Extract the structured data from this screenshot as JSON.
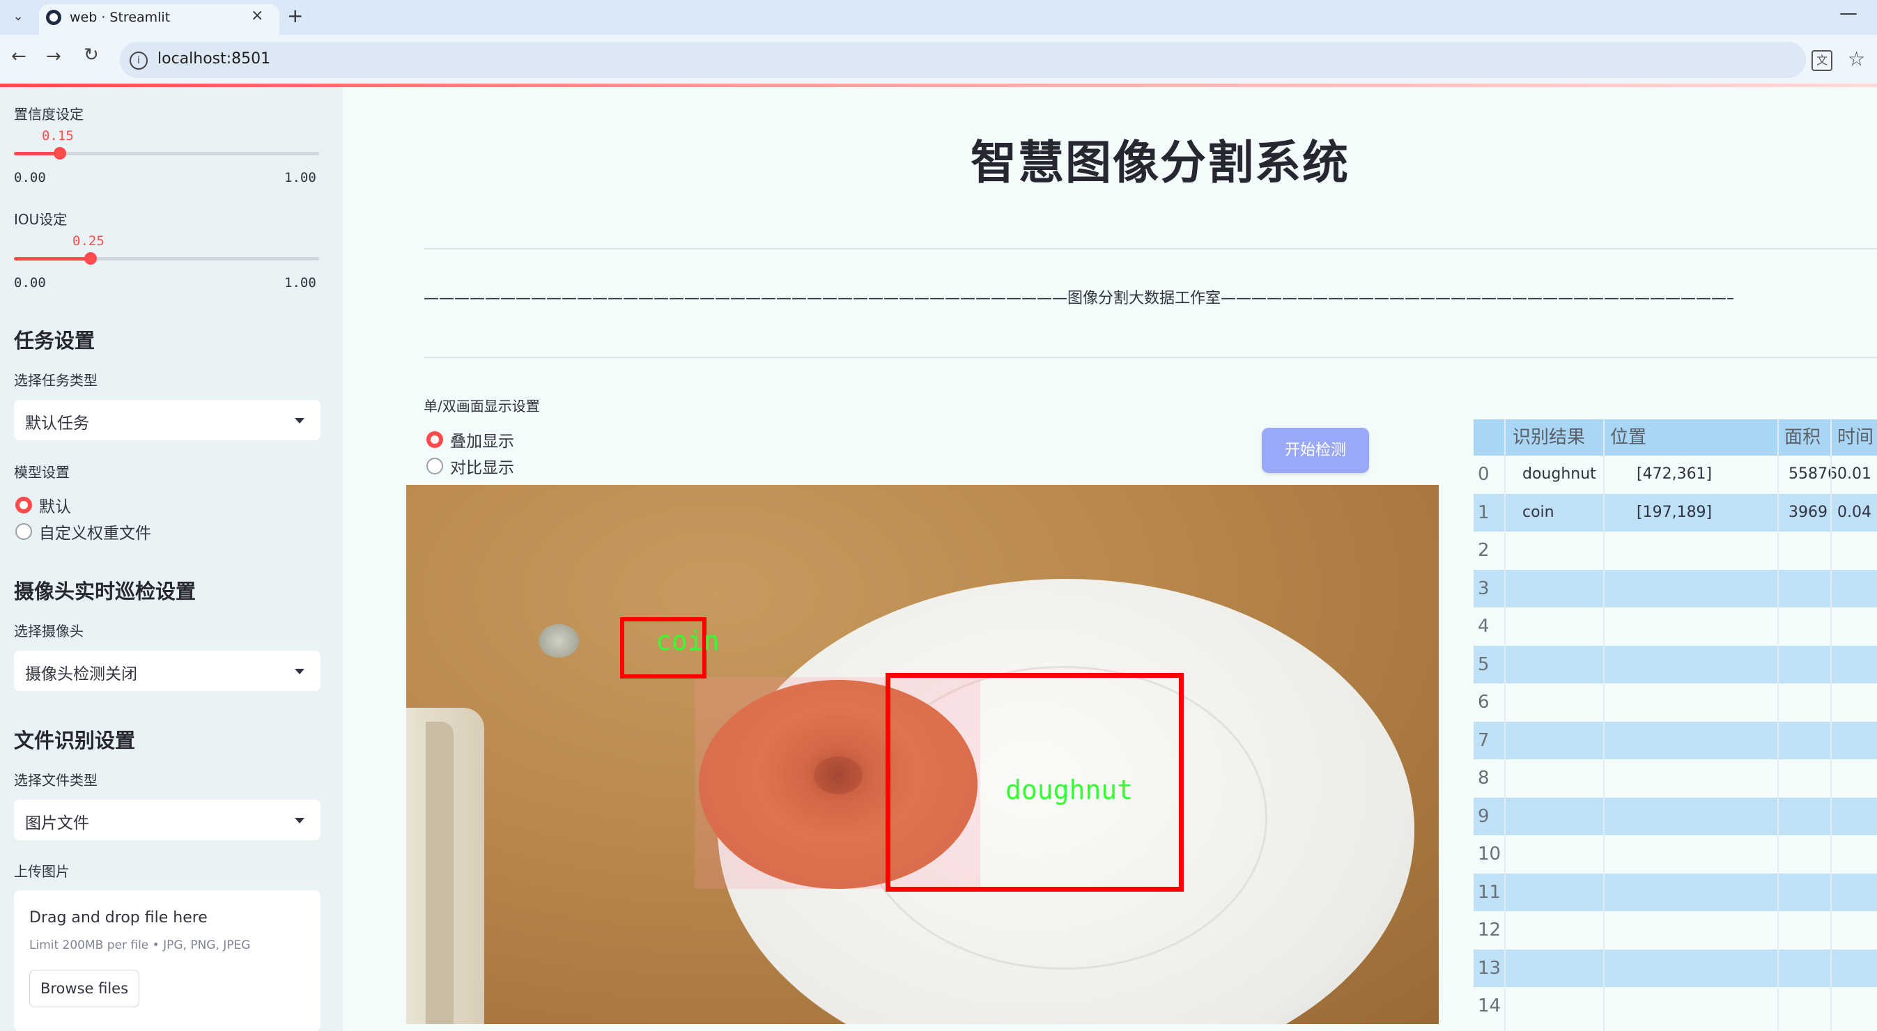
{
  "browser": {
    "tab_title": "web · Streamlit",
    "url": "localhost:8501",
    "new_tab": "+",
    "close": "×",
    "minimize": "—"
  },
  "sidebar": {
    "confidence_label": "置信度设定",
    "confidence_value": "0.15",
    "confidence": 0.15,
    "iou_label": "IOU设定",
    "iou_value": "0.25",
    "iou": 0.25,
    "slider_min": "0.00",
    "slider_max": "1.00",
    "task_heading": "任务设置",
    "task_type_label": "选择任务类型",
    "task_type_value": "默认任务",
    "model_label": "模型设置",
    "model_options": [
      "默认",
      "自定义权重文件"
    ],
    "model_selected": "默认",
    "camera_heading": "摄像头实时巡检设置",
    "camera_label": "选择摄像头",
    "camera_value": "摄像头检测关闭",
    "file_heading": "文件识别设置",
    "file_type_label": "选择文件类型",
    "file_type_value": "图片文件",
    "upload_label": "上传图片",
    "drop_title": "Drag and drop file here",
    "drop_limit": "Limit 200MB per file • JPG, PNG, JPEG",
    "browse_button": "Browse files"
  },
  "main": {
    "title": "智慧图像分割系统",
    "studio_line": "——————————————————————————————————————————图像分割大数据工作室——————————————————————————————————————————",
    "display_label": "单/双画面显示设置",
    "display_options": [
      "叠加显示",
      "对比显示"
    ],
    "display_selected": "叠加显示",
    "start_button": "开始检测",
    "detections": [
      {
        "label": "coin"
      },
      {
        "label": "doughnut"
      }
    ]
  },
  "table": {
    "headers": [
      "识别结果",
      "位置",
      "面积",
      "时间"
    ],
    "rows": [
      {
        "idx": "0",
        "result": "doughnut",
        "position": "[472,361]",
        "area": "55876",
        "time": "0.01"
      },
      {
        "idx": "1",
        "result": "coin",
        "position": "[197,189]",
        "area": "3969",
        "time": "0.04"
      },
      {
        "idx": "2",
        "result": "",
        "position": "",
        "area": "",
        "time": ""
      },
      {
        "idx": "3",
        "result": "",
        "position": "",
        "area": "",
        "time": ""
      },
      {
        "idx": "4",
        "result": "",
        "position": "",
        "area": "",
        "time": ""
      },
      {
        "idx": "5",
        "result": "",
        "position": "",
        "area": "",
        "time": ""
      },
      {
        "idx": "6",
        "result": "",
        "position": "",
        "area": "",
        "time": ""
      },
      {
        "idx": "7",
        "result": "",
        "position": "",
        "area": "",
        "time": ""
      },
      {
        "idx": "8",
        "result": "",
        "position": "",
        "area": "",
        "time": ""
      },
      {
        "idx": "9",
        "result": "",
        "position": "",
        "area": "",
        "time": ""
      },
      {
        "idx": "10",
        "result": "",
        "position": "",
        "area": "",
        "time": ""
      },
      {
        "idx": "11",
        "result": "",
        "position": "",
        "area": "",
        "time": ""
      },
      {
        "idx": "12",
        "result": "",
        "position": "",
        "area": "",
        "time": ""
      },
      {
        "idx": "13",
        "result": "",
        "position": "",
        "area": "",
        "time": ""
      },
      {
        "idx": "14",
        "result": "",
        "position": "",
        "area": "",
        "time": ""
      }
    ]
  },
  "colors": {
    "accent": "#ff4b4b",
    "button": "#9aa8f8",
    "box": "#ff0000",
    "label": "#33ff33",
    "table_blue": "#bfe1f7"
  }
}
